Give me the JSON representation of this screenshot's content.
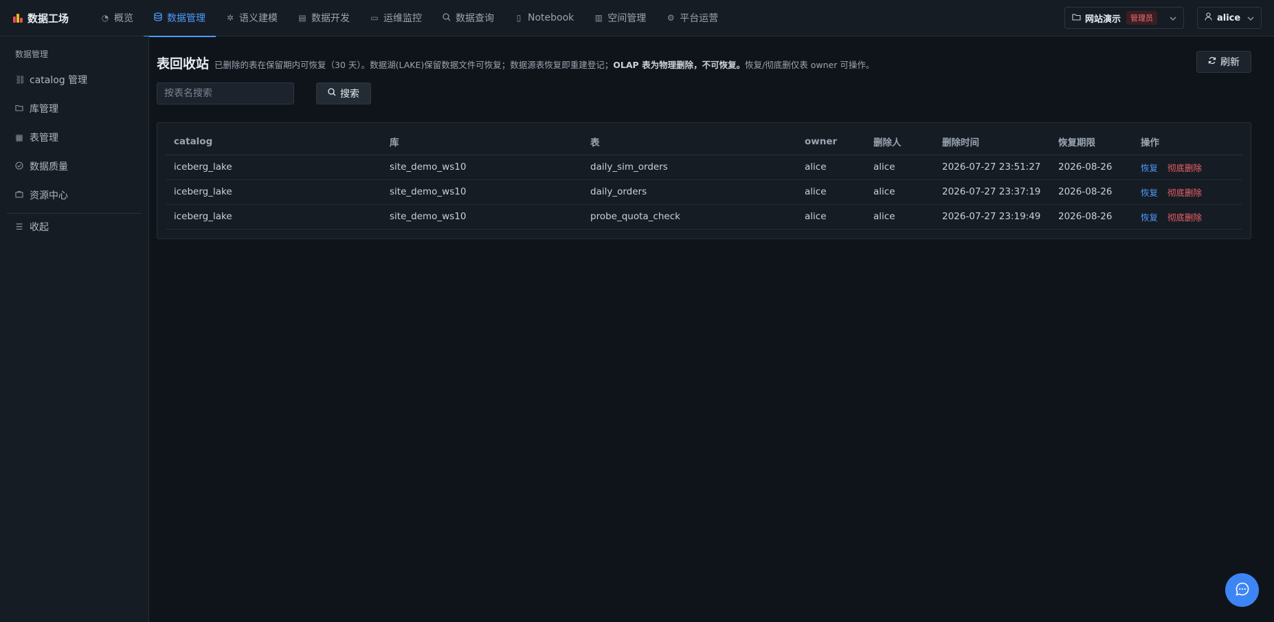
{
  "brand": {
    "title": "数据工场"
  },
  "nav": [
    {
      "label": "概览",
      "icon": "gauge-icon"
    },
    {
      "label": "数据管理",
      "icon": "database-icon"
    },
    {
      "label": "语义建模",
      "icon": "sparkle-icon"
    },
    {
      "label": "数据开发",
      "icon": "code-file-icon"
    },
    {
      "label": "运维监控",
      "icon": "monitor-icon"
    },
    {
      "label": "数据查询",
      "icon": "search-icon"
    },
    {
      "label": "Notebook",
      "icon": "notebook-icon"
    },
    {
      "label": "空间管理",
      "icon": "building-icon"
    },
    {
      "label": "平台运营",
      "icon": "gear-icon"
    }
  ],
  "workspace": {
    "name": "网站演示",
    "role": "管理员"
  },
  "user": {
    "name": "alice"
  },
  "sidebar": {
    "title": "数据管理",
    "items": [
      {
        "label": "catalog 管理",
        "icon": "link-icon"
      },
      {
        "label": "库管理",
        "icon": "folder-icon"
      },
      {
        "label": "表管理",
        "icon": "table-icon"
      },
      {
        "label": "数据质量",
        "icon": "check-circle-icon"
      },
      {
        "label": "资源中心",
        "icon": "briefcase-icon"
      }
    ],
    "collapse_label": "收起"
  },
  "main": {
    "title": "表回收站",
    "desc_part1": "已删除的表在保留期内可恢复（30 天）。数据湖(LAKE)保留数据文件可恢复；数据源表恢复即重建登记；",
    "desc_bold": "OLAP 表为物理删除，不可恢复。",
    "desc_part2": "恢复/彻底删仅表 owner 可操作。",
    "refresh_label": "刷新",
    "search_placeholder": "按表名搜索",
    "search_label": "搜索",
    "table": {
      "columns": [
        "catalog",
        "库",
        "表",
        "owner",
        "删除人",
        "删除时间",
        "恢复期限",
        "操作"
      ],
      "rows": [
        [
          "iceberg_lake",
          "site_demo_ws10",
          "daily_sim_orders",
          "alice",
          "alice",
          "2026-07-27 23:51:27",
          "2026-08-26"
        ],
        [
          "iceberg_lake",
          "site_demo_ws10",
          "daily_orders",
          "alice",
          "alice",
          "2026-07-27 23:37:19",
          "2026-08-26"
        ],
        [
          "iceberg_lake",
          "site_demo_ws10",
          "probe_quota_check",
          "alice",
          "alice",
          "2026-07-27 23:19:49",
          "2026-08-26"
        ]
      ],
      "action_restore": "恢复",
      "action_purge": "彻底删除"
    }
  },
  "colors": {
    "accent": "#4f9bff",
    "danger": "#f0636a",
    "background": "#0f141a",
    "panel": "#161c23"
  }
}
